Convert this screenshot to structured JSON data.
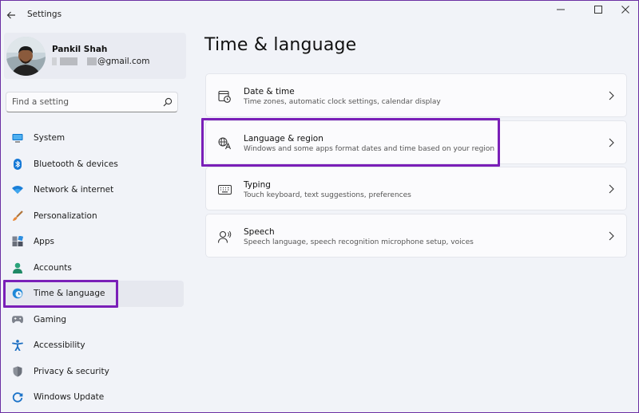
{
  "window": {
    "title": "Settings"
  },
  "profile": {
    "name": "Pankil Shah",
    "email_suffix": "@gmail.com"
  },
  "search": {
    "placeholder": "Find a setting"
  },
  "sidebar": {
    "items": [
      {
        "label": "System",
        "icon": "monitor-icon",
        "active": false
      },
      {
        "label": "Bluetooth & devices",
        "icon": "bluetooth-icon",
        "active": false
      },
      {
        "label": "Network & internet",
        "icon": "wifi-icon",
        "active": false
      },
      {
        "label": "Personalization",
        "icon": "brush-icon",
        "active": false
      },
      {
        "label": "Apps",
        "icon": "apps-icon",
        "active": false
      },
      {
        "label": "Accounts",
        "icon": "person-icon",
        "active": false
      },
      {
        "label": "Time & language",
        "icon": "globe-clock-icon",
        "active": true
      },
      {
        "label": "Gaming",
        "icon": "gamepad-icon",
        "active": false
      },
      {
        "label": "Accessibility",
        "icon": "accessibility-icon",
        "active": false
      },
      {
        "label": "Privacy & security",
        "icon": "shield-icon",
        "active": false
      },
      {
        "label": "Windows Update",
        "icon": "update-icon",
        "active": false
      }
    ]
  },
  "main": {
    "title": "Time & language",
    "cards": [
      {
        "title": "Date & time",
        "description": "Time zones, automatic clock settings, calendar display",
        "icon": "calendar-clock-icon"
      },
      {
        "title": "Language & region",
        "description": "Windows and some apps format dates and time based on your region",
        "icon": "language-icon"
      },
      {
        "title": "Typing",
        "description": "Touch keyboard, text suggestions, preferences",
        "icon": "keyboard-icon"
      },
      {
        "title": "Speech",
        "description": "Speech language, speech recognition microphone setup, voices",
        "icon": "speech-icon"
      }
    ]
  },
  "colors": {
    "highlight": "#7a1fb8",
    "accent": "#0067c0"
  }
}
